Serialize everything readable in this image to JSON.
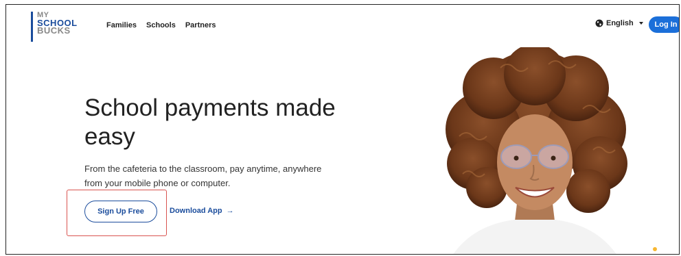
{
  "logo": {
    "line1": "MY",
    "line2": "SCHOOL",
    "line3": "BUCKS"
  },
  "nav": {
    "items": [
      "Families",
      "Schools",
      "Partners"
    ]
  },
  "header": {
    "language": "English",
    "login_label": "Log In"
  },
  "hero": {
    "headline": "School payments made easy",
    "subtext": "From the cafeteria to the classroom, pay anytime, anywhere from your mobile phone or computer.",
    "signup_label": "Sign Up Free",
    "download_label": "Download App",
    "download_arrow": "→"
  },
  "colors": {
    "brand_blue": "#1a4c9c",
    "button_blue": "#1b6fd9",
    "highlight_red": "#d9534f",
    "accent_yellow": "#f7b731"
  },
  "icons": {
    "language": "globe-icon",
    "dropdown": "caret-down-icon",
    "download": "arrow-right-icon"
  }
}
